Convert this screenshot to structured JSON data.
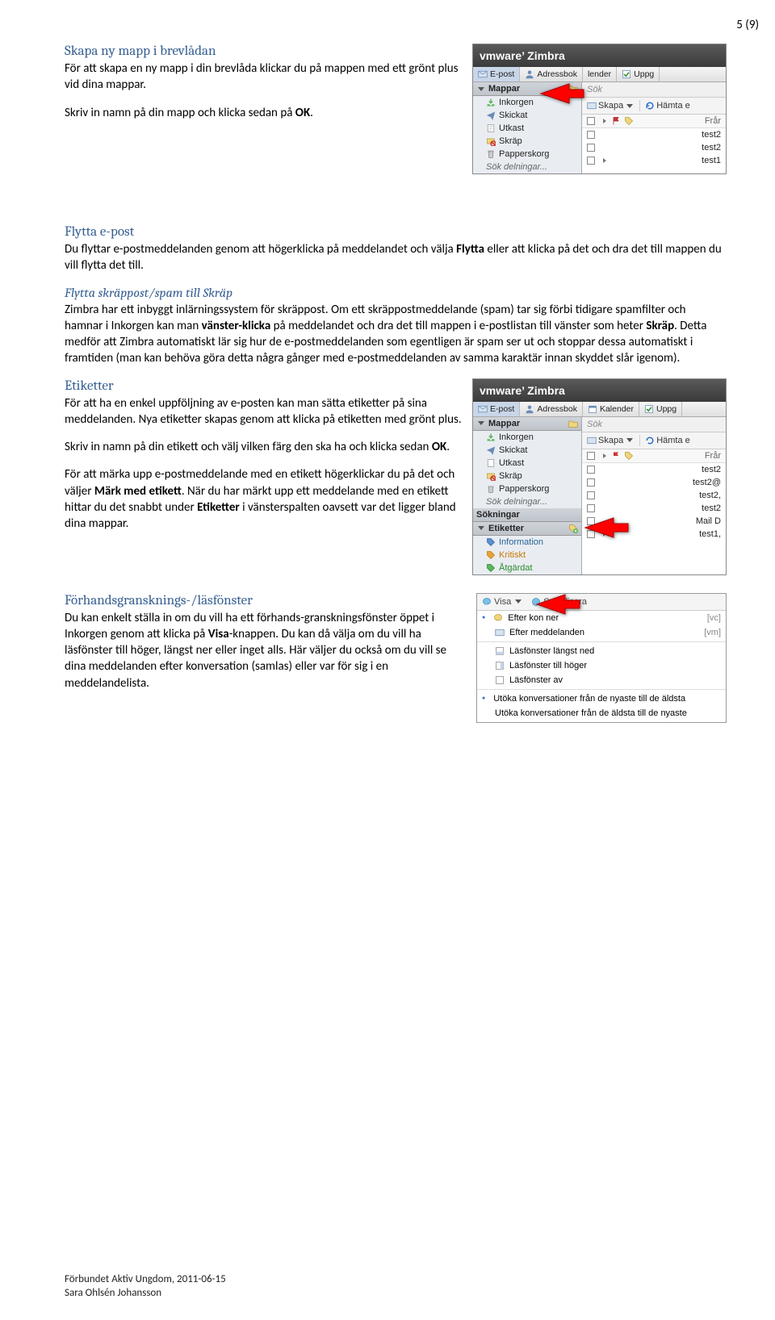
{
  "page_number": "5 (9)",
  "sections": {
    "skapa": {
      "title": "Skapa ny mapp i brevlådan",
      "p1a": "För att skapa en ny mapp i din brevlåda klickar du på mappen med ett grönt plus vid dina mappar.",
      "p2a": "Skriv in namn på din mapp och klicka sedan på ",
      "p2b": "OK",
      "p2c": "."
    },
    "flytta": {
      "title": "Flytta e-post",
      "p1a": "Du flyttar e-postmeddelanden genom att högerklicka på meddelandet och välja ",
      "p1b": "Flytta",
      "p1c": " eller att klicka på det och dra det till mappen du vill flytta det till."
    },
    "skrap": {
      "title": "Flytta skräppost/spam till Skräp",
      "p1a": "Zimbra har ett inbyggt inlärningssystem för skräppost. Om ett skräppostmeddelande (spam) tar sig förbi tidigare spamfilter och hamnar i Inkorgen kan man ",
      "p1b": "vänster-klicka",
      "p1c": " på meddelandet och dra det till mappen i e-postlistan till vänster som heter ",
      "p1d": "Skräp",
      "p1e": ". Detta medför att Zimbra automatiskt lär sig hur de e-postmeddelanden som egentligen är spam ser ut och stoppar dessa automatiskt i framtiden (man kan behöva göra detta några gånger med e-postmeddelanden av samma karaktär innan skyddet slår igenom)."
    },
    "etiketter": {
      "title": "Etiketter",
      "p1": "För att ha en enkel uppföljning av e-posten kan man sätta etiketter på sina meddelanden. Nya etiketter skapas genom att klicka på etiketten med grönt plus.",
      "p2a": "Skriv in namn på din etikett och välj vilken färg den ska ha och klicka sedan ",
      "p2b": "OK",
      "p2c": ".",
      "p3a": "För att märka upp e-postmeddelande med en etikett högerklickar du på det och väljer ",
      "p3b": "Märk med etikett",
      "p3c": ". När du har märkt upp ett meddelande med en etikett hittar du det snabbt under ",
      "p3d": "Etiketter",
      "p3e": " i vänsterspalten oavsett var det ligger bland dina mappar."
    },
    "forhand": {
      "title": "Förhandsgransknings-/läsfönster",
      "p1a": "Du kan enkelt ställa in om du vill ha ett förhands-granskningsfönster öppet i Inkorgen genom att klicka på ",
      "p1b": "Visa",
      "p1c": "-knappen. Du kan då välja om du vill ha läsfönster till höger, längst ner eller inget alls. Här väljer du också om du vill se dina meddelanden efter konversation (samlas) eller var för sig i en meddelandelista."
    }
  },
  "zimbra1": {
    "brand": "vmware’ Zimbra",
    "tabs": {
      "epost": "E-post",
      "adressbok": "Adressbok",
      "kalender": "lender",
      "uppg": "Uppg"
    },
    "sidebar": {
      "mappar": "Mappar",
      "items": [
        "Inkorgen",
        "Skickat",
        "Utkast",
        "Skräp",
        "Papperskorg",
        "Sök delningar..."
      ]
    },
    "main": {
      "search": "Sök",
      "skapa": "Skapa",
      "hamta": "Hämta e",
      "from": "Frår",
      "rows": [
        "test2",
        "test2",
        "test1"
      ]
    }
  },
  "zimbra2": {
    "brand": "vmware’ Zimbra",
    "tabs": {
      "epost": "E-post",
      "adressbok": "Adressbok",
      "kalender": "Kalender",
      "uppg": "Uppg"
    },
    "sidebar": {
      "mappar": "Mappar",
      "items": [
        "Inkorgen",
        "Skickat",
        "Utkast",
        "Skräp",
        "Papperskorg",
        "Sök delningar..."
      ],
      "sokningar": "Sökningar",
      "etiketter": "Etiketter",
      "etikett_items": [
        "Information",
        "Kritiskt",
        "Åtgärdat"
      ]
    },
    "main": {
      "search": "Sök",
      "skapa": "Skapa",
      "hamta": "Hämta e",
      "from": "Frår",
      "rows": [
        "test2",
        "test2@",
        "test2,",
        "test2",
        "Mail D",
        "test1,"
      ]
    }
  },
  "menu": {
    "visa": "Visa",
    "socialisera": "Socialisera",
    "efter_konv": "Efter kon             ner",
    "efter_konv_kb": "[vc]",
    "efter_medd": "Efter meddelanden",
    "efter_medd_kb": "[vm]",
    "las_ned": "Läsfönster längst ned",
    "las_hog": "Läsfönster till höger",
    "las_av": "Läsfönster av",
    "utoka1": "Utöka konversationer från de nyaste till de äldsta",
    "utoka2": "Utöka konversationer från de äldsta till de nyaste"
  },
  "footer": {
    "line1": "Förbundet Aktiv Ungdom, 2011-06-15",
    "line2": "Sara Ohlsén Johansson"
  }
}
